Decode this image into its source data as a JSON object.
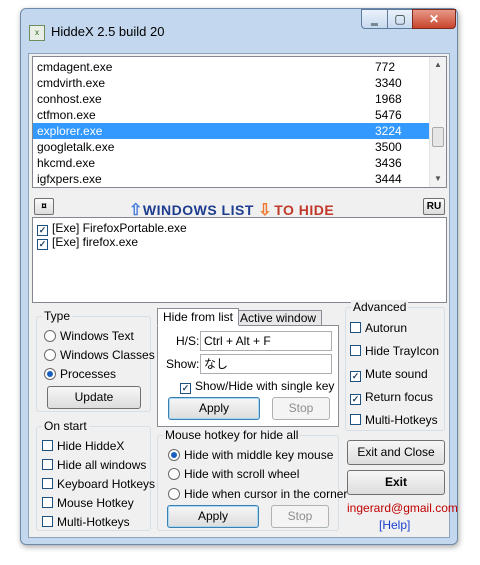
{
  "window": {
    "title": "HiddeX 2.5 build 20",
    "app_icon_text": "x",
    "min_glyph": "‗",
    "max_glyph": "▢",
    "close_glyph": "✕"
  },
  "processes": {
    "rows": [
      {
        "name": "cmdagent.exe",
        "pid": "772"
      },
      {
        "name": "cmdvirth.exe",
        "pid": "3340"
      },
      {
        "name": "conhost.exe",
        "pid": "1968"
      },
      {
        "name": "ctfmon.exe",
        "pid": "5476"
      },
      {
        "name": "explorer.exe",
        "pid": "3224"
      },
      {
        "name": "googletalk.exe",
        "pid": "3500"
      },
      {
        "name": "hkcmd.exe",
        "pid": "3436"
      },
      {
        "name": "igfxpers.exe",
        "pid": "3444"
      }
    ],
    "selected_index": 4,
    "scroll_up_glyph": "▲",
    "scroll_down_glyph": "▼"
  },
  "banner": {
    "left_button": "¤",
    "up_arrow": "⇧",
    "windows_list": "WINDOWS LIST",
    "down_arrow": "⇩",
    "to_hide": "TO HIDE",
    "right_button": "RU"
  },
  "hide_list": {
    "items": [
      {
        "label": "[Exe] FirefoxPortable.exe",
        "checked": true
      },
      {
        "label": "[Exe] firefox.exe",
        "checked": true
      }
    ]
  },
  "type_group": {
    "title": "Type",
    "options": [
      "Windows Text",
      "Windows Classes",
      "Processes"
    ],
    "selected": "Processes",
    "update_button": "Update"
  },
  "on_start": {
    "title": "On start",
    "options": [
      {
        "label": "Hide HiddeX",
        "checked": false
      },
      {
        "label": "Hide all windows",
        "checked": false
      },
      {
        "label": "Keyboard Hotkeys",
        "checked": false
      },
      {
        "label": "Mouse Hotkey",
        "checked": false
      },
      {
        "label": "Multi-Hotkeys",
        "checked": false
      }
    ]
  },
  "tabs": {
    "items": [
      "Hide from list",
      "Active window"
    ],
    "active": "Hide from list",
    "hs_label": "H/S:",
    "hs_value": "Ctrl + Alt + F",
    "show_label": "Show:",
    "show_value": "なし",
    "single_key_label": "Show/Hide with single key",
    "single_key_checked": true,
    "apply": "Apply",
    "stop": "Stop"
  },
  "mouse_hotkey": {
    "title": "Mouse hotkey for hide all",
    "options": [
      "Hide with middle key mouse",
      "Hide with scroll wheel",
      "Hide when cursor in the corner"
    ],
    "selected": "Hide with middle key mouse",
    "apply": "Apply",
    "stop": "Stop"
  },
  "advanced": {
    "title": "Advanced",
    "options": [
      {
        "label": "Autorun",
        "checked": false
      },
      {
        "label": "Hide TrayIcon",
        "checked": false
      },
      {
        "label": "Mute sound",
        "checked": true
      },
      {
        "label": "Return focus",
        "checked": true
      },
      {
        "label": "Multi-Hotkeys",
        "checked": false
      }
    ]
  },
  "actions": {
    "exit_close": "Exit and Close",
    "exit": "Exit",
    "email": "ingerard@gmail.com",
    "help": "[Help]"
  },
  "check_glyph": "✓",
  "colors": {
    "selection": "#3399ff",
    "window_frame": "#c3d8ee",
    "email": "#c00000",
    "help_link": "#1a3fcf",
    "windows_list": "#1e3d8f",
    "to_hide": "#c0392b"
  }
}
